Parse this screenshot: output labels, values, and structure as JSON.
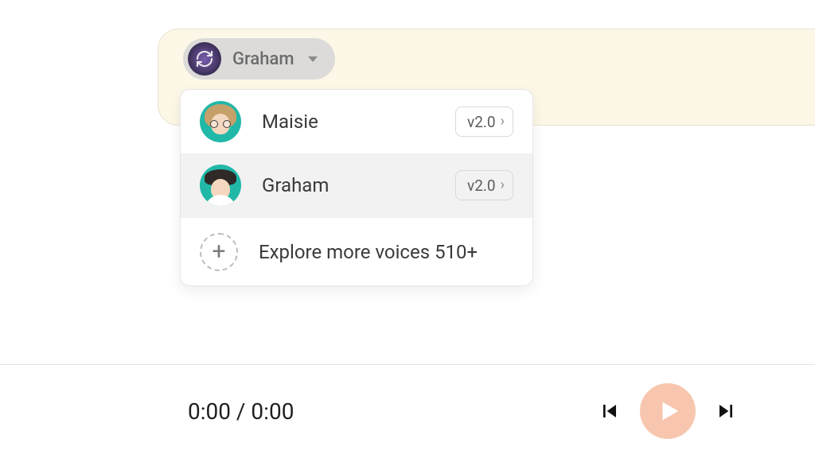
{
  "voice_selector": {
    "selected_name": "Graham"
  },
  "dropdown": {
    "items": [
      {
        "name": "Maisie",
        "version": "v2.0",
        "selected": false
      },
      {
        "name": "Graham",
        "version": "v2.0",
        "selected": true
      }
    ],
    "explore_label": "Explore more voices 510+"
  },
  "player": {
    "time_display": "0:00 / 0:00"
  }
}
